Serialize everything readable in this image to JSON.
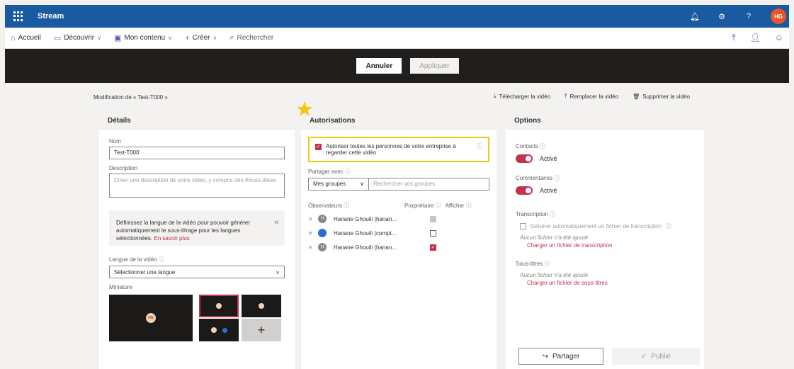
{
  "topbar": {
    "brand": "Stream",
    "avatar": "HG",
    "help": "?"
  },
  "nav": {
    "home": "Accueil",
    "discover": "Découvrir",
    "mycontent": "Mon contenu",
    "create": "Créer",
    "search": "Rechercher"
  },
  "actions": {
    "cancel": "Annuler",
    "apply": "Appliquer"
  },
  "breadcrumb": "Modification de « Test-T000 »",
  "top_actions": {
    "download": "Télécharger la vidéo",
    "replace": "Remplacer la vidéo",
    "delete": "Supprimer la vidéo"
  },
  "details": {
    "header": "Détails",
    "name_label": "Nom",
    "name_value": "Test-T000",
    "desc_label": "Description",
    "desc_placeholder": "Créer une description de votre vidéo, y compris des #mots-dièse",
    "info_text": "Définissez la langue de la vidéo pour pouvoir générer automatiquement le sous-titrage pour les langues sélectionnées.",
    "info_link": "En savoir plus",
    "lang_label": "Langue de la vidéo",
    "lang_value": "Sélectionner une langue",
    "thumb_label": "Miniature",
    "thumb_avatar": "HG"
  },
  "perms": {
    "header": "Autorisations",
    "allow_text": "Autoriser toutes les personnes de votre entreprise à regarder cette vidéo",
    "share_label": "Partager avec",
    "share_dd": "Mes groupes",
    "share_search": "Rechercher vos groupes",
    "col_observers": "Observateurs",
    "col_owner": "Propriétaire",
    "col_show": "Afficher",
    "rows": [
      {
        "name": "Hanane Ghouili (hanan...",
        "avatar": "H"
      },
      {
        "name": "Hanane Ghouili (compt...",
        "avatar": ""
      },
      {
        "name": "Hanane Ghouili (hanan...",
        "avatar": "H"
      }
    ]
  },
  "options": {
    "header": "Options",
    "contacts_label": "Contacts",
    "contacts_state": "Activé",
    "comments_label": "Commentaires",
    "comments_state": "Activé",
    "transcription_label": "Transcription",
    "transcription_gen": "Générer automatiquement un fichier de transcription",
    "transcription_none": "Aucun fichier n'a été ajouté",
    "transcription_upload": "Charger un fichier de transcription",
    "subtitles_label": "Sous-titres",
    "subtitles_none": "Aucun fichier n'a été ajouté",
    "subtitles_upload": "Charger un fichier de sous-titres",
    "share_button": "Partager",
    "published_button": "Publié"
  },
  "colors": {
    "brand_blue": "#1a5aa0",
    "accent_red": "#c4314b",
    "highlight_yellow": "#f2c811"
  }
}
